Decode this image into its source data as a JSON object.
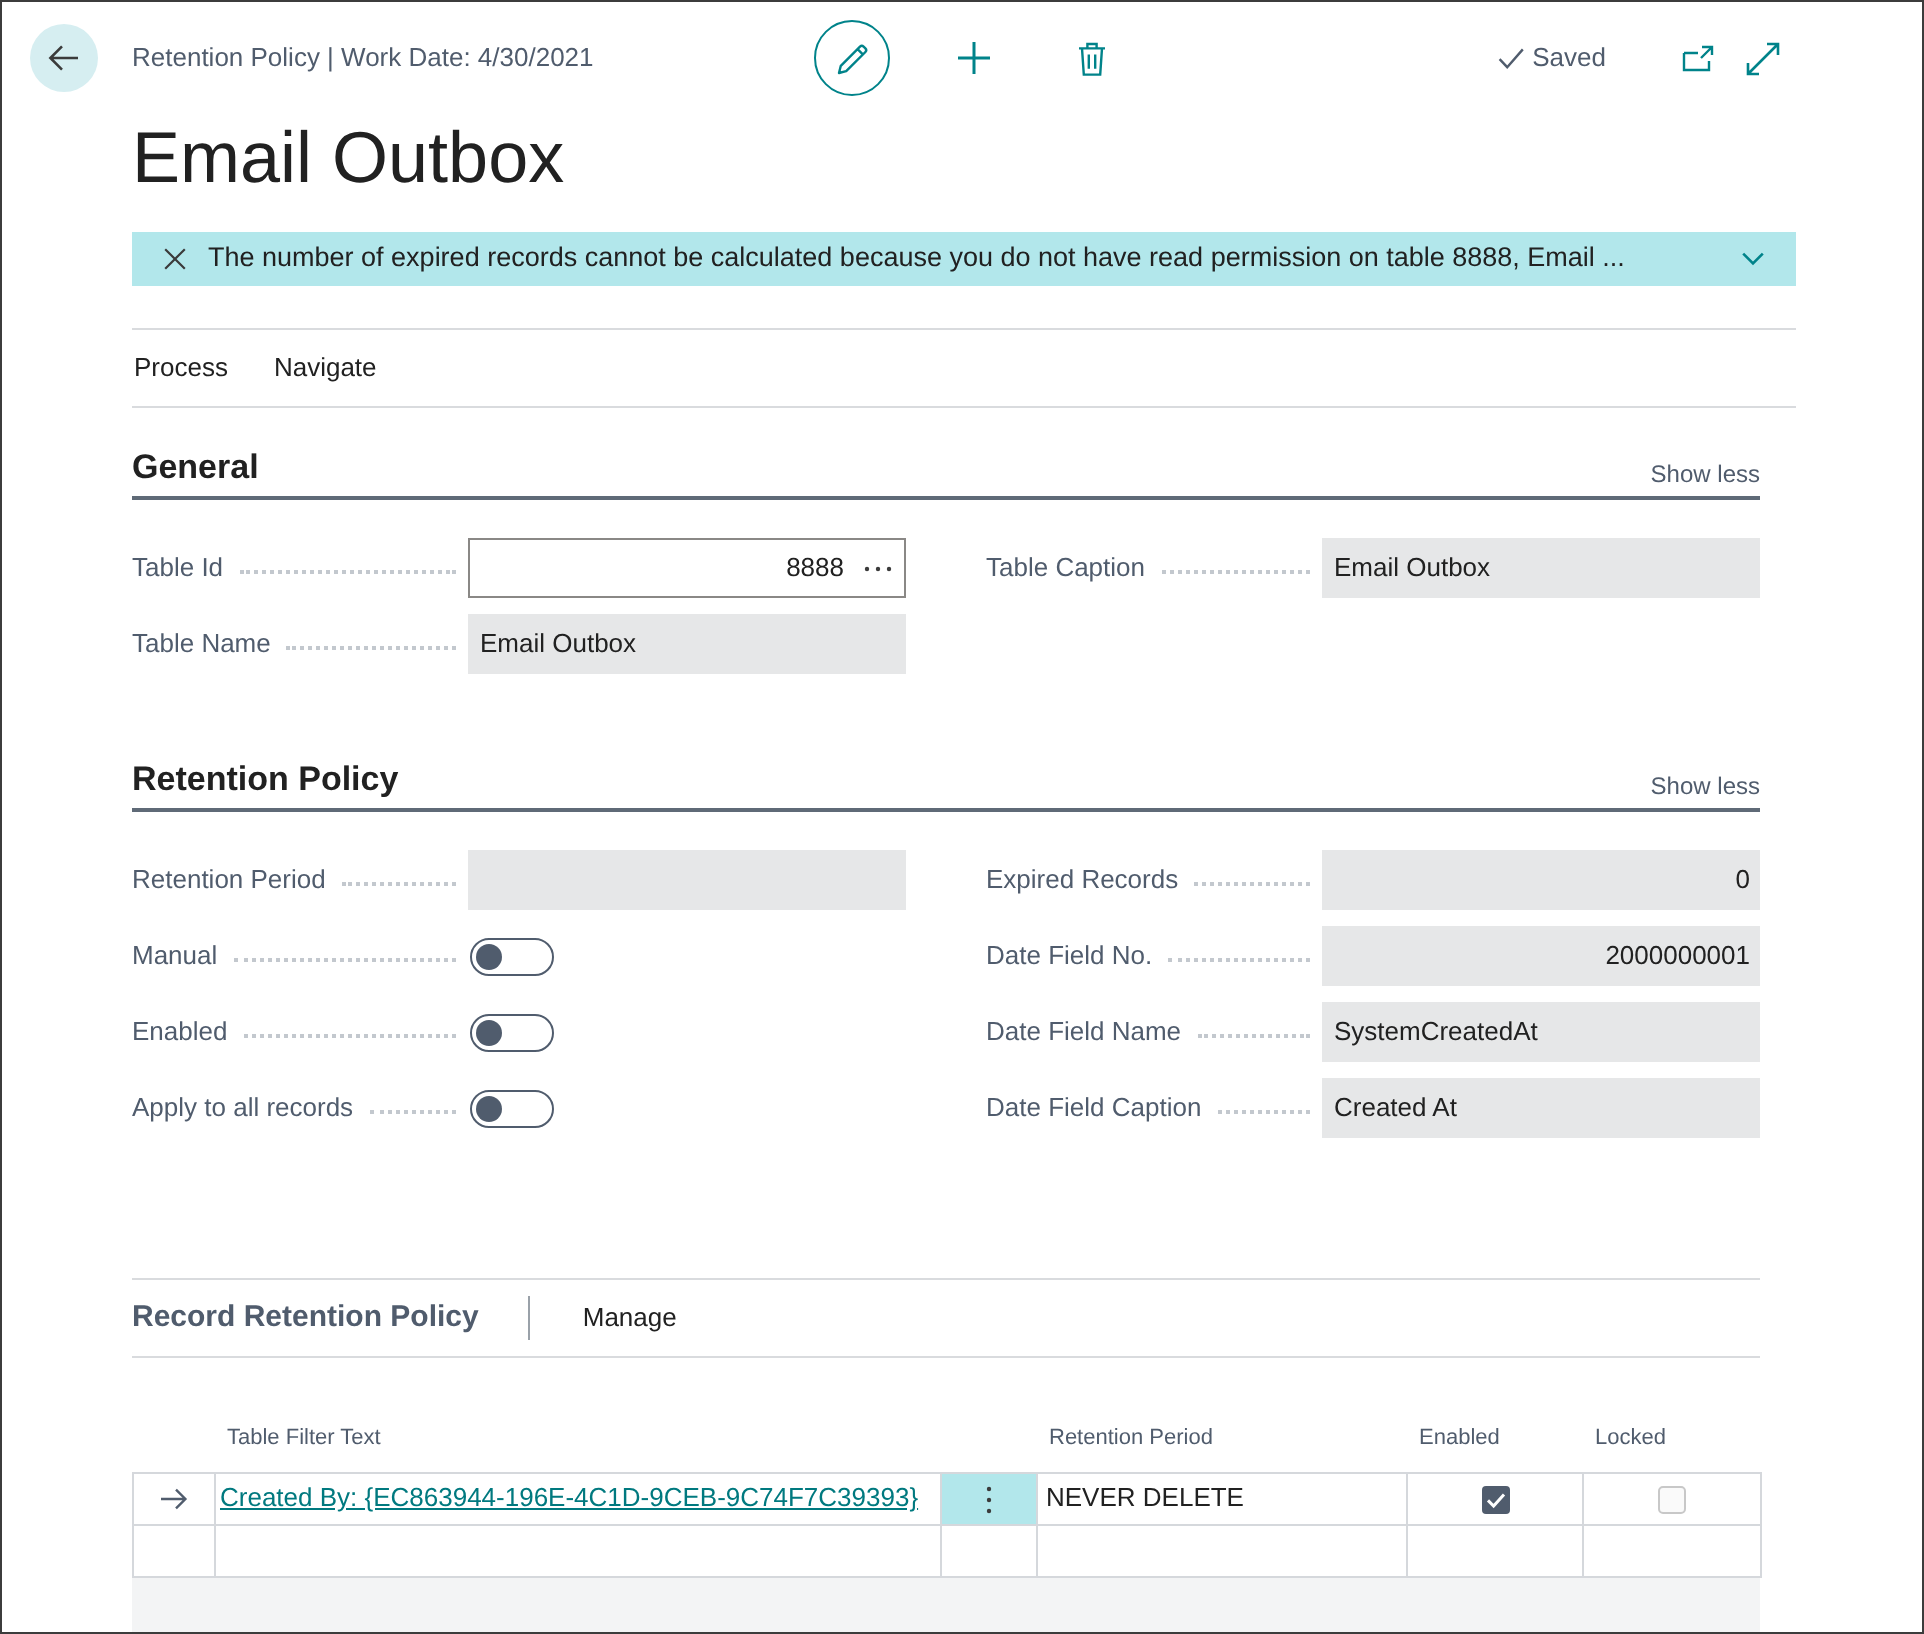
{
  "header": {
    "breadcrumb": "Retention Policy | Work Date: 4/30/2021",
    "save_status": "Saved"
  },
  "title": "Email Outbox",
  "notification": {
    "message": "The number of expired records cannot be calculated because you do not have read permission on table 8888, Email ..."
  },
  "action_bar": [
    {
      "label": "Process"
    },
    {
      "label": "Navigate"
    }
  ],
  "sections": [
    {
      "title": "General",
      "toggle": "Show less",
      "columns": [
        [
          {
            "label": "Table Id",
            "kind": "lookup",
            "value": "8888"
          },
          {
            "label": "Table Name",
            "kind": "text",
            "value": "Email Outbox"
          }
        ],
        [
          {
            "label": "Table Caption",
            "kind": "text",
            "value": "Email Outbox"
          }
        ]
      ]
    },
    {
      "title": "Retention Policy",
      "toggle": "Show less",
      "columns": [
        [
          {
            "label": "Retention Period",
            "kind": "text"
          },
          {
            "label": "Manual",
            "kind": "toggle",
            "on": false
          },
          {
            "label": "Enabled",
            "kind": "toggle",
            "on": false
          },
          {
            "label": "Apply to all records",
            "kind": "toggle",
            "on": false
          }
        ],
        [
          {
            "label": "Expired Records",
            "kind": "number",
            "value": "0"
          },
          {
            "label": "Date Field No.",
            "kind": "number",
            "value": "2000000001"
          },
          {
            "label": "Date Field Name",
            "kind": "text",
            "value": "SystemCreatedAt"
          },
          {
            "label": "Date Field Caption",
            "kind": "text",
            "value": "Created At"
          }
        ]
      ]
    }
  ],
  "subpage": {
    "title": "Record Retention Policy",
    "actions": [
      {
        "label": "Manage"
      }
    ],
    "columns": [
      "Table Filter Text",
      "Retention Period",
      "Enabled",
      "Locked"
    ],
    "rows": [
      {
        "selected": true,
        "table_filter_text": "Created By: {EC863944-196E-4C1D-9CEB-9C74F7C39393}",
        "retention_period": "NEVER DELETE",
        "enabled": {
          "checked": true
        },
        "locked": {
          "checked": false,
          "disabled": true
        }
      }
    ]
  }
}
